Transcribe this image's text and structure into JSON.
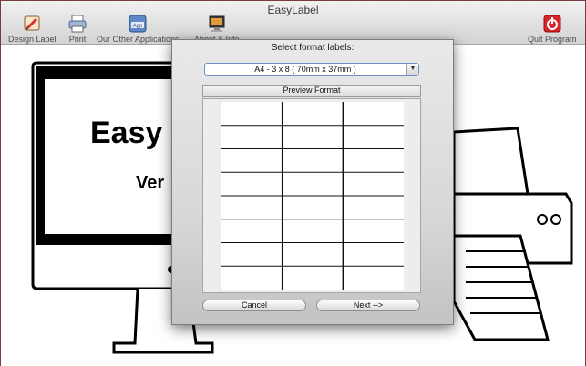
{
  "window": {
    "title": "EasyLabel"
  },
  "toolbar": {
    "items": [
      {
        "label": "Design Label",
        "icon": "design-label-icon"
      },
      {
        "label": "Print",
        "icon": "printer-icon"
      },
      {
        "label": "Our Other Applications",
        "icon": "app-store-icon",
        "badge": "App"
      },
      {
        "label": "About & Info",
        "icon": "about-info-icon"
      },
      {
        "label": "Quit Program",
        "icon": "quit-icon"
      }
    ]
  },
  "background": {
    "heading": "Easy",
    "subheading": "Ver"
  },
  "dialog": {
    "title": "Select format labels:",
    "format_select": {
      "value": "A4 - 3 x 8 ( 70mm x 37mm )",
      "arrow": "▼"
    },
    "preview_header": "Preview Format",
    "preview": {
      "columns": 3,
      "rows": 8
    },
    "cancel_label": "Cancel",
    "next_label": "Next -->"
  },
  "colors": {
    "window_border": "#7a3b3f",
    "quit_red": "#d8252b",
    "select_focus": "#6d8fc4"
  }
}
